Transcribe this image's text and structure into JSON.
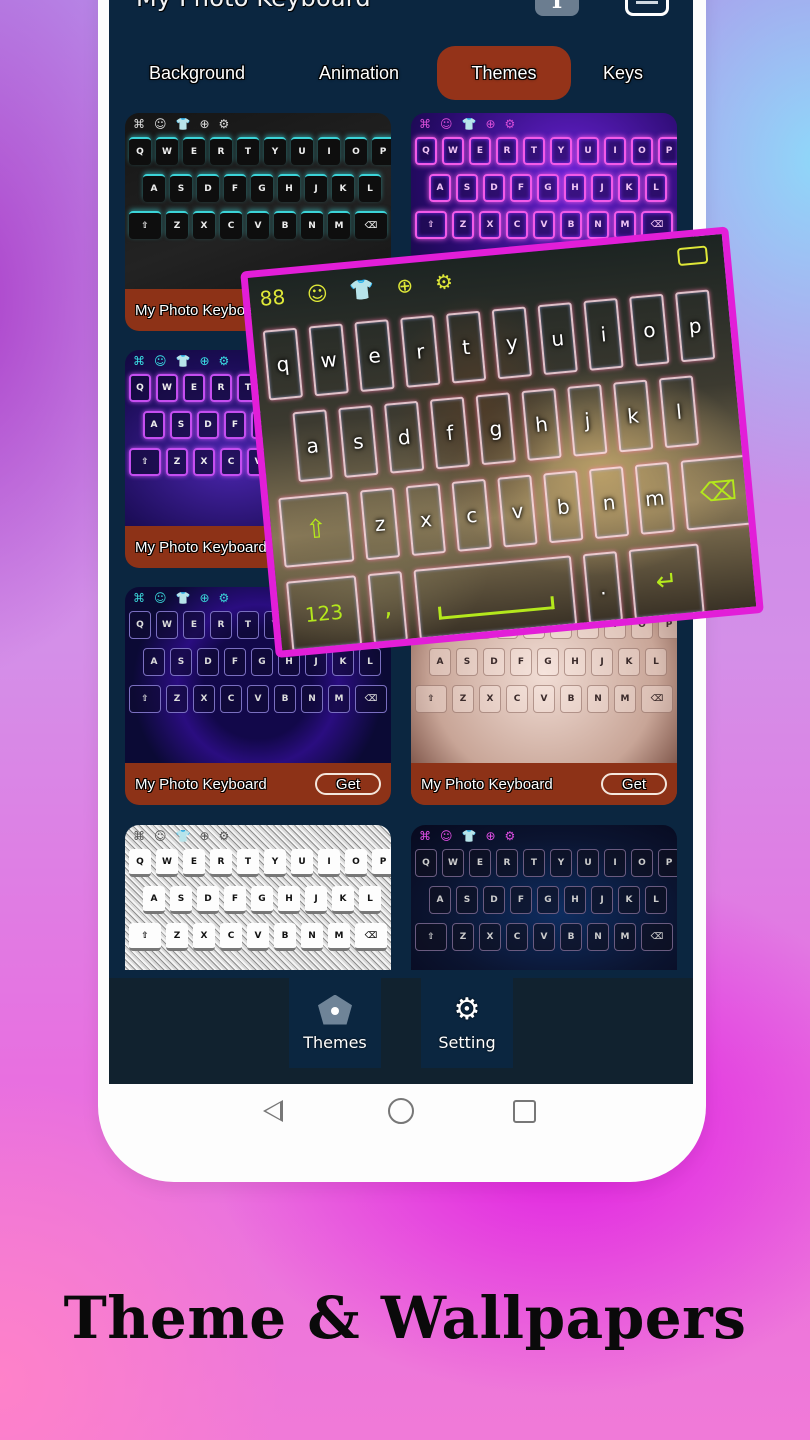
{
  "app": {
    "title": "My Photo Keyboard",
    "font_icon": "font-size-icon",
    "font_glyph": "T",
    "menu_icon": "menu-icon"
  },
  "tabs": [
    {
      "label": "Background",
      "active": false
    },
    {
      "label": "Animation",
      "active": false
    },
    {
      "label": "Themes",
      "active": true
    },
    {
      "label": "Keys",
      "active": false
    }
  ],
  "keyboard_toolbar_glyphs": [
    "⌘",
    "☺",
    "👕",
    "⊕",
    "⚙"
  ],
  "keyboard_rows_upper": [
    [
      "Q",
      "W",
      "E",
      "R",
      "T",
      "Y",
      "U",
      "I",
      "O",
      "P"
    ],
    [
      "A",
      "S",
      "D",
      "F",
      "G",
      "H",
      "J",
      "K",
      "L"
    ],
    [
      "⇧",
      "Z",
      "X",
      "C",
      "V",
      "B",
      "N",
      "M",
      "⌫"
    ]
  ],
  "themes": [
    {
      "name": "My Photo Keyboard",
      "style": "neon-cyan-hex",
      "get_label": ""
    },
    {
      "name": "My Photo Keyboard",
      "style": "neon-laser",
      "get_label": ""
    },
    {
      "name": "My Photo Keyboard",
      "style": "neon-palm",
      "get_label": ""
    },
    {
      "name": "My Photo Keyboard",
      "style": "neon-ring-palm",
      "get_label": "Get"
    },
    {
      "name": "My Photo Keyboard",
      "style": "red-bow",
      "get_label": "Get"
    },
    {
      "name": "",
      "style": "silver-glitter",
      "get_label": ""
    },
    {
      "name": "",
      "style": "neon-finger-heart",
      "get_label": ""
    }
  ],
  "featured_keyboard": {
    "style": "cat-rider-atv-photo",
    "accent": "#e21ed8",
    "key_accent": "#b4e81c",
    "toolbar_icons": [
      "apps-icon",
      "emoji-icon",
      "theme-icon",
      "globe-icon",
      "settings-icon",
      "keyboard-icon"
    ],
    "toolbar_glyphs": [
      "88",
      "☺",
      "👕",
      "⊕",
      "⚙"
    ],
    "rows": [
      [
        "q",
        "w",
        "e",
        "r",
        "t",
        "y",
        "u",
        "i",
        "o",
        "p"
      ],
      [
        "a",
        "s",
        "d",
        "f",
        "g",
        "h",
        "j",
        "k",
        "l"
      ],
      [
        "⇧",
        "z",
        "x",
        "c",
        "v",
        "b",
        "n",
        "m",
        "⌫"
      ]
    ],
    "bottom_row": {
      "numbers": "123",
      "comma": ",",
      "period": ".",
      "enter": "↵"
    }
  },
  "bottom_nav": [
    {
      "label": "Themes",
      "icon": "themes-pentagon-icon"
    },
    {
      "label": "Setting",
      "icon": "gear-icon",
      "glyph": "⚙"
    }
  ],
  "system_nav": [
    "back-icon",
    "home-icon",
    "recents-icon"
  ],
  "caption": "Theme & Wallpapers",
  "colors": {
    "screen_bg": "#0b2640",
    "tab_active": "#943319",
    "card_footer": "#8d3217",
    "bottom_nav_bg": "#11222f"
  }
}
